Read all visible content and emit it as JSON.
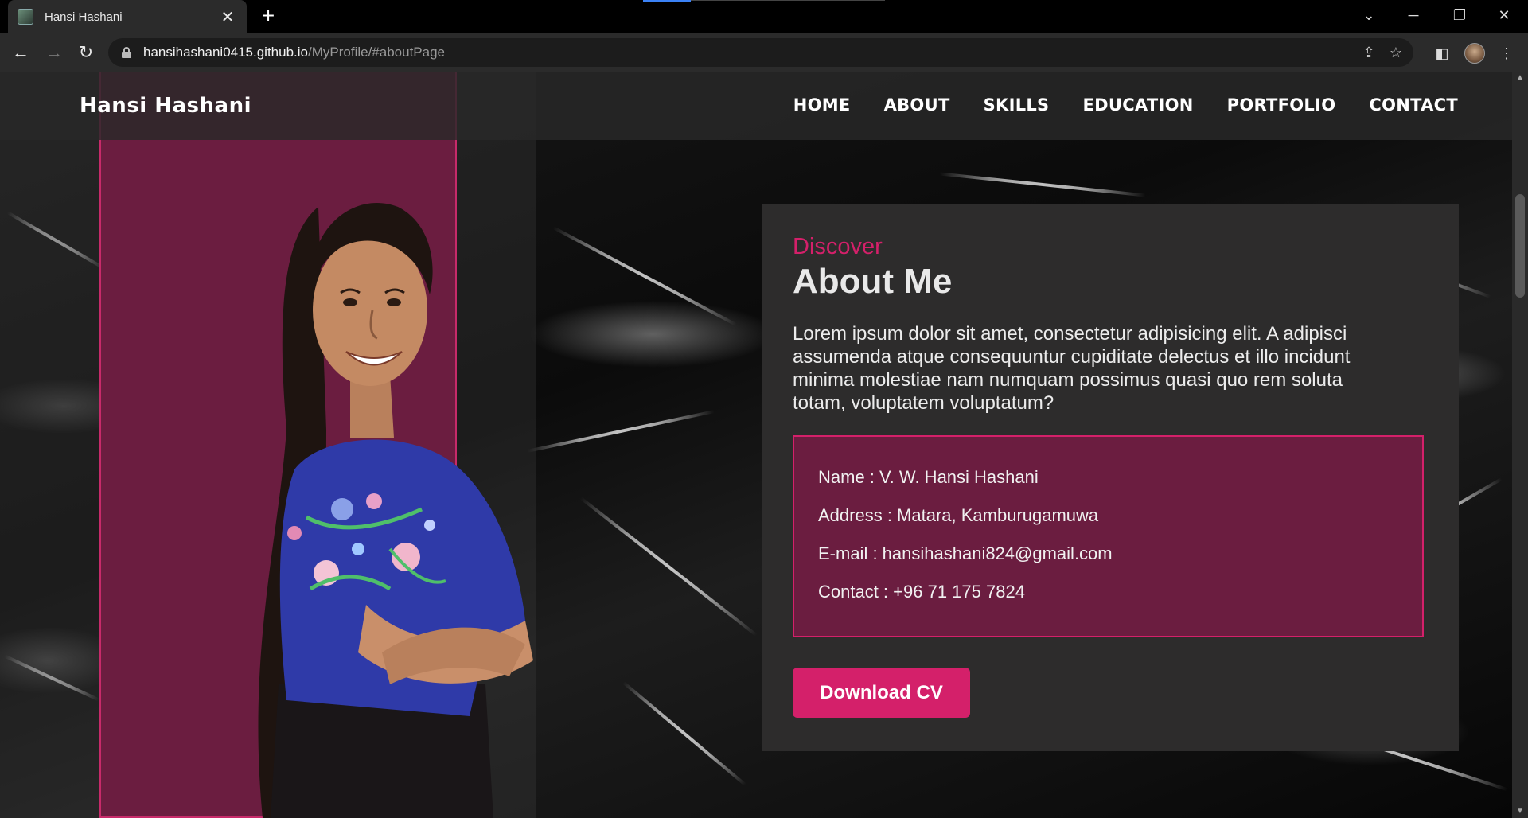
{
  "browser": {
    "tab_title": "Hansi Hashani",
    "url_host": "hansihashani0415.github.io",
    "url_path": "/MyProfile/#aboutPage"
  },
  "site": {
    "brand": "Hansi Hashani",
    "nav": [
      "HOME",
      "ABOUT",
      "SKILLS",
      "EDUCATION",
      "PORTFOLIO",
      "CONTACT"
    ]
  },
  "about": {
    "eyebrow": "Discover",
    "title": "About Me",
    "text": "Lorem ipsum dolor sit amet, consectetur adipisicing elit. A adipisci assumenda atque consequuntur cupiditate delectus et illo incidunt minima molestiae nam numquam possimus quasi quo rem soluta totam, voluptatem voluptatum?",
    "info": [
      "Name : V. W. Hansi Hashani",
      "Address : Matara, Kamburugamuwa",
      "E-mail : hansihashani824@gmail.com",
      "Contact : +96 71 175 7824"
    ],
    "button": "Download CV"
  },
  "colors": {
    "accent": "#d4206a",
    "panel": "#6b1d40",
    "card": "#2d2c2c"
  }
}
